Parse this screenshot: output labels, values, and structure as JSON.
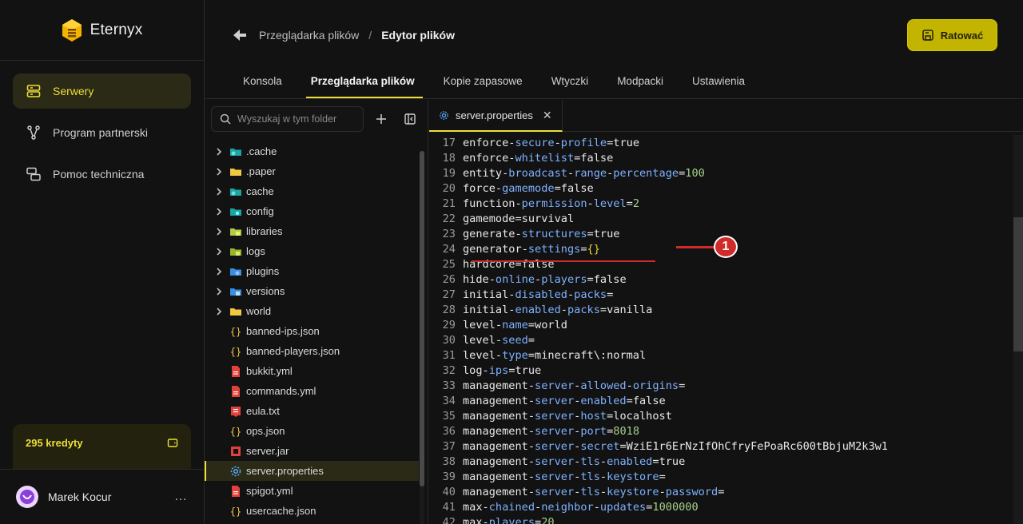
{
  "brand": {
    "name": "Eternyx"
  },
  "sidebar": {
    "items": [
      {
        "label": "Serwery",
        "icon": "server-icon",
        "active": true
      },
      {
        "label": "Program partnerski",
        "icon": "share-nodes-icon",
        "active": false
      },
      {
        "label": "Pomoc techniczna",
        "icon": "support-chat-icon",
        "active": false
      }
    ],
    "credits": "295 kredyty",
    "user": {
      "name": "Marek Kocur",
      "menu": "…"
    }
  },
  "header": {
    "breadcrumb": {
      "parent": "Przeglądarka plików",
      "separator": "/",
      "current": "Edytor plików"
    },
    "save_label": "Ratować",
    "tabs": [
      {
        "label": "Konsola"
      },
      {
        "label": "Przeglądarka plików"
      },
      {
        "label": "Kopie zapasowe"
      },
      {
        "label": "Wtyczki"
      },
      {
        "label": "Modpacki"
      },
      {
        "label": "Ustawienia"
      }
    ]
  },
  "files": {
    "search_placeholder": "Wyszukaj w tym folder",
    "items": [
      {
        "name": ".cache",
        "type": "folder",
        "icon": "folder-cache-icon"
      },
      {
        "name": ".paper",
        "type": "folder",
        "icon": "folder-icon"
      },
      {
        "name": "cache",
        "type": "folder",
        "icon": "folder-cache-icon"
      },
      {
        "name": "config",
        "type": "folder",
        "icon": "folder-config-icon"
      },
      {
        "name": "libraries",
        "type": "folder",
        "icon": "folder-lib-icon"
      },
      {
        "name": "logs",
        "type": "folder",
        "icon": "folder-logs-icon"
      },
      {
        "name": "plugins",
        "type": "folder",
        "icon": "folder-plugins-icon"
      },
      {
        "name": "versions",
        "type": "folder",
        "icon": "folder-versions-icon"
      },
      {
        "name": "world",
        "type": "folder",
        "icon": "folder-icon"
      },
      {
        "name": "banned-ips.json",
        "type": "json",
        "icon": "json-icon"
      },
      {
        "name": "banned-players.json",
        "type": "json",
        "icon": "json-icon"
      },
      {
        "name": "bukkit.yml",
        "type": "yml",
        "icon": "yaml-icon"
      },
      {
        "name": "commands.yml",
        "type": "yml",
        "icon": "yaml-icon"
      },
      {
        "name": "eula.txt",
        "type": "txt",
        "icon": "txt-icon"
      },
      {
        "name": "ops.json",
        "type": "json",
        "icon": "json-icon"
      },
      {
        "name": "server.jar",
        "type": "jar",
        "icon": "jar-icon"
      },
      {
        "name": "server.properties",
        "type": "properties",
        "icon": "gear-icon",
        "active": true
      },
      {
        "name": "spigot.yml",
        "type": "yml",
        "icon": "yaml-icon"
      },
      {
        "name": "usercache.json",
        "type": "json",
        "icon": "json-icon"
      }
    ]
  },
  "editor": {
    "tab_name": "server.properties",
    "lines": [
      {
        "n": "17",
        "text": "enforce-secure-profile=true"
      },
      {
        "n": "18",
        "text": "enforce-whitelist=false"
      },
      {
        "n": "19",
        "text": "entity-broadcast-range-percentage=100"
      },
      {
        "n": "20",
        "text": "force-gamemode=false"
      },
      {
        "n": "21",
        "text": "function-permission-level=2"
      },
      {
        "n": "22",
        "text": "gamemode=survival"
      },
      {
        "n": "23",
        "text": "generate-structures=true"
      },
      {
        "n": "24",
        "text": "generator-settings={}"
      },
      {
        "n": "25",
        "text": "hardcore=false"
      },
      {
        "n": "26",
        "text": "hide-online-players=false"
      },
      {
        "n": "27",
        "text": "initial-disabled-packs="
      },
      {
        "n": "28",
        "text": "initial-enabled-packs=vanilla"
      },
      {
        "n": "29",
        "text": "level-name=world"
      },
      {
        "n": "30",
        "text": "level-seed="
      },
      {
        "n": "31",
        "text": "level-type=minecraft\\:normal"
      },
      {
        "n": "32",
        "text": "log-ips=true"
      },
      {
        "n": "33",
        "text": "management-server-allowed-origins="
      },
      {
        "n": "34",
        "text": "management-server-enabled=false"
      },
      {
        "n": "35",
        "text": "management-server-host=localhost"
      },
      {
        "n": "36",
        "text": "management-server-port=8018"
      },
      {
        "n": "37",
        "text": "management-server-secret=WziE1r6ErNzIfOhCfryFePoaRc600tBbjuM2k3w1"
      },
      {
        "n": "38",
        "text": "management-server-tls-enabled=true"
      },
      {
        "n": "39",
        "text": "management-server-tls-keystore="
      },
      {
        "n": "40",
        "text": "management-server-tls-keystore-password="
      },
      {
        "n": "41",
        "text": "max-chained-neighbor-updates=1000000"
      },
      {
        "n": "42",
        "text": "max-players=20"
      }
    ]
  },
  "annotation": {
    "label": "1"
  }
}
